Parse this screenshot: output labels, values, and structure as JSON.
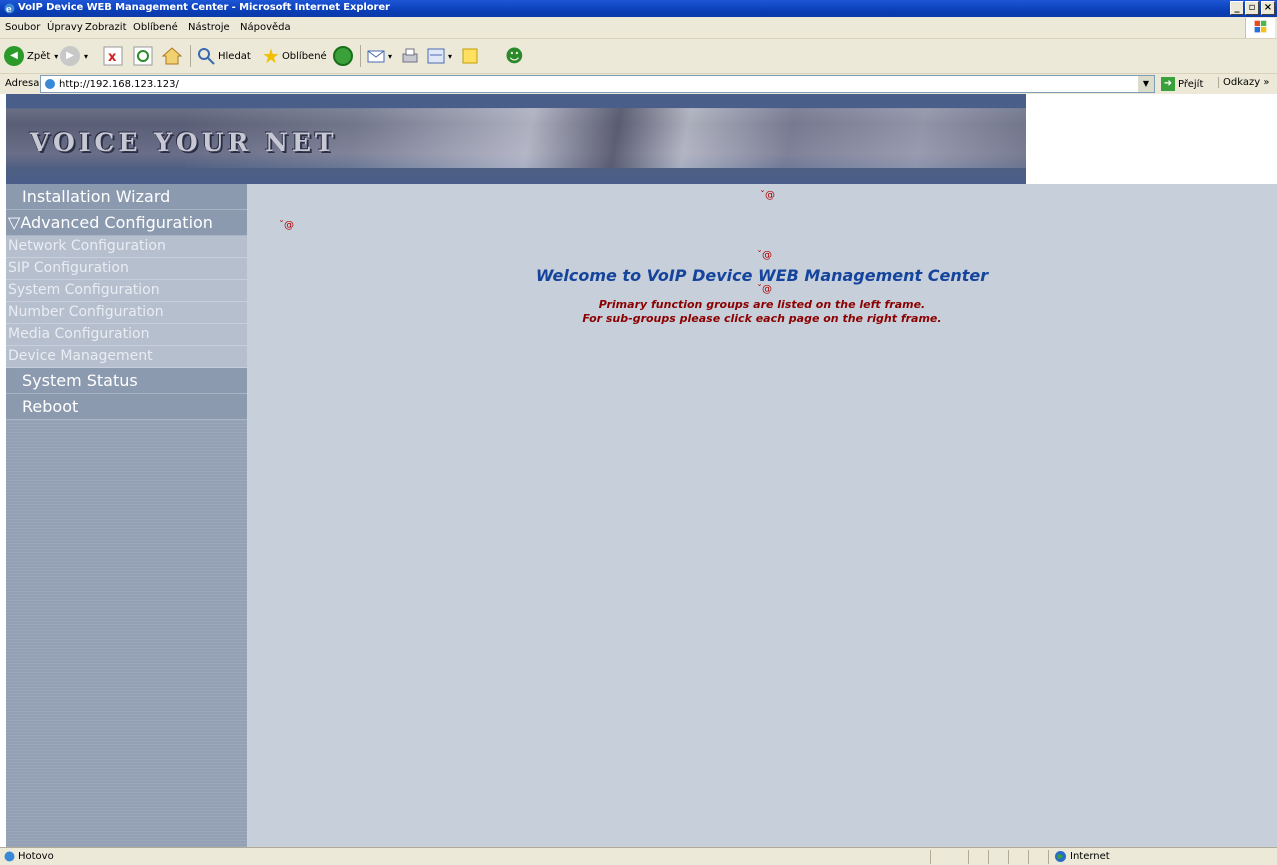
{
  "window": {
    "title": "VoIP Device WEB Management Center - Microsoft Internet Explorer",
    "minimize": "_",
    "maximize": "▫",
    "close": "×"
  },
  "menu": [
    "Soubor",
    "Úpravy",
    "Zobrazit",
    "Oblíbené",
    "Nástroje",
    "Nápověda"
  ],
  "toolbar": {
    "back_label": "Zpět",
    "search_label": "Hledat",
    "favorites_label": "Oblíbené"
  },
  "address": {
    "label": "Adresa",
    "url": "http://192.168.123.123/",
    "go_label": "Přejít",
    "links_label": "Odkazy"
  },
  "banner": {
    "logo_text": "VOICE YOUR NET"
  },
  "nav": {
    "installation_wizard": "Installation Wizard",
    "advanced_configuration": "Advanced Configuration",
    "advanced_arrow": "▽",
    "sub_items": [
      "Network Configuration",
      "SIP Configuration",
      "System Configuration",
      "Number Configuration",
      "Media Configuration",
      "Device Management"
    ],
    "system_status": "System Status",
    "reboot": "Reboot"
  },
  "main": {
    "marker": "ˇ@",
    "welcome": "Welcome to VoIP Device WEB Management Center",
    "line1": "Primary function groups are listed on the left frame.",
    "line2": "For sub-groups please click each page on the right frame."
  },
  "status": {
    "text": "Hotovo",
    "zone": "Internet"
  },
  "colors": {
    "nav_main_bg": "#8c9ab0",
    "nav_sub_bg": "#b6bfcd",
    "main_bg": "#c7d0da",
    "welcome_color": "#15449c",
    "note_color": "#8b0000"
  }
}
